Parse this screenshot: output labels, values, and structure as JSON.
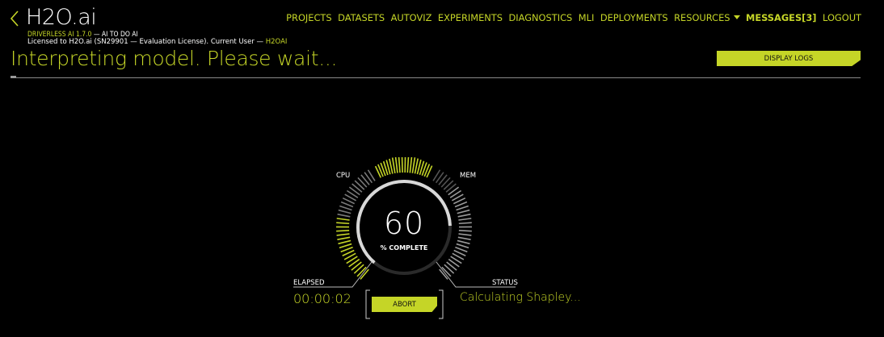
{
  "header": {
    "brand": "H2O.ai",
    "product_name": "DRIVERLESS AI 1.7.0",
    "tagline": " — AI TO DO AI",
    "license_text": "Licensed to H2O.ai (SN29901 — Evaluation License). Current User — ",
    "current_user": "H2OAI"
  },
  "nav": {
    "items": [
      {
        "label": "PROJECTS"
      },
      {
        "label": "DATASETS"
      },
      {
        "label": "AUTOVIZ"
      },
      {
        "label": "EXPERIMENTS"
      },
      {
        "label": "DIAGNOSTICS"
      },
      {
        "label": "MLI"
      },
      {
        "label": "DEPLOYMENTS"
      },
      {
        "label": "RESOURCES"
      },
      {
        "label": "MESSAGES[3]"
      },
      {
        "label": "LOGOUT"
      }
    ]
  },
  "main": {
    "title": "Interpreting model. Please wait...",
    "display_logs_label": "DISPLAY LOGS"
  },
  "gauge": {
    "percent": 60,
    "percent_label": "60",
    "complete_label": "% COMPLETE",
    "cpu_label": "CPU",
    "mem_label": "MEM",
    "cpu_level": 0.55,
    "mem_level": 0.8,
    "elapsed_label": "ELAPSED",
    "elapsed_value": "00:00:02",
    "status_label": "STATUS",
    "status_value": "Calculating Shapley...",
    "abort_label": "ABORT"
  },
  "colors": {
    "accent": "#c5d527",
    "background": "#000000",
    "text": "#ffffff",
    "inactive_tick": "#7a7a7a"
  }
}
